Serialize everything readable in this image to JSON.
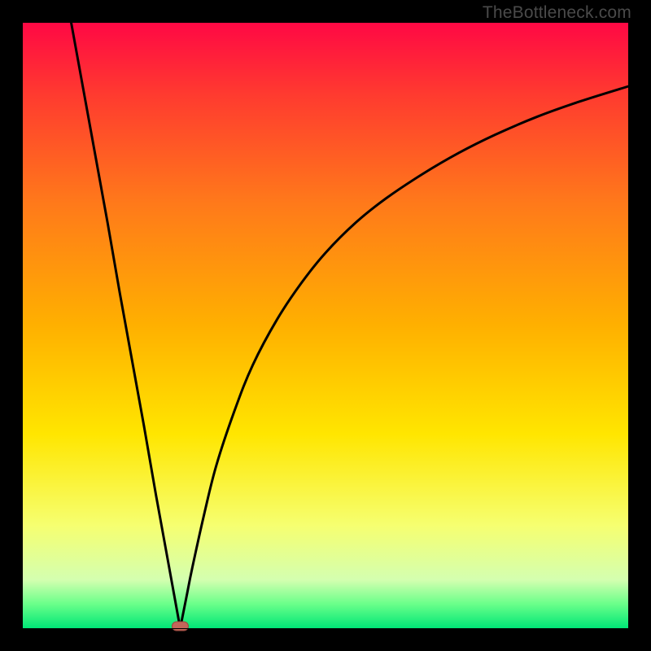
{
  "watermark": "TheBottleneck.com",
  "colors": {
    "frame": "#000000",
    "grad_top": "#ff0844",
    "grad_upper": "#ff3b2f",
    "grad_mid_upper": "#ff7a1a",
    "grad_mid": "#ffb000",
    "grad_mid_lower": "#ffe600",
    "grad_lower": "#f6ff70",
    "grad_green_top": "#d4ffb0",
    "grad_green_mid": "#6aff8a",
    "grad_green_bottom": "#00e676",
    "curve": "#000000",
    "dot_fill": "#c4665a",
    "dot_stroke": "#9a4a40"
  },
  "chart_data": {
    "type": "line",
    "title": "",
    "xlabel": "",
    "ylabel": "",
    "xlim": [
      0,
      100
    ],
    "ylim": [
      0,
      100
    ],
    "notch_x": 26,
    "marker": {
      "x": 26,
      "y": 0
    },
    "series": [
      {
        "name": "left-branch",
        "x": [
          8,
          10,
          12,
          14,
          16,
          18,
          20,
          22,
          24,
          25,
          26
        ],
        "values": [
          100,
          89,
          78,
          67,
          55.5,
          44.5,
          33.5,
          22,
          11,
          5.5,
          0
        ]
      },
      {
        "name": "right-branch",
        "x": [
          26,
          27,
          28,
          30,
          32,
          35,
          38,
          42,
          46,
          50,
          55,
          60,
          66,
          72,
          78,
          85,
          92,
          100
        ],
        "values": [
          0,
          5,
          10,
          19,
          27,
          36,
          43.5,
          51,
          57,
          62,
          67,
          71,
          75,
          78.5,
          81.5,
          84.5,
          87,
          89.5
        ]
      }
    ],
    "gradient_stops": [
      {
        "pct": 0,
        "color": "#ff0844"
      },
      {
        "pct": 12,
        "color": "#ff3b2f"
      },
      {
        "pct": 30,
        "color": "#ff7a1a"
      },
      {
        "pct": 50,
        "color": "#ffb000"
      },
      {
        "pct": 68,
        "color": "#ffe600"
      },
      {
        "pct": 83,
        "color": "#f6ff70"
      },
      {
        "pct": 92,
        "color": "#d4ffb0"
      },
      {
        "pct": 96,
        "color": "#6aff8a"
      },
      {
        "pct": 100,
        "color": "#00e676"
      }
    ]
  },
  "plot_geometry": {
    "outer_w": 800,
    "outer_h": 800,
    "inner_x": 28,
    "inner_y": 28,
    "inner_w": 744,
    "inner_h": 744
  }
}
